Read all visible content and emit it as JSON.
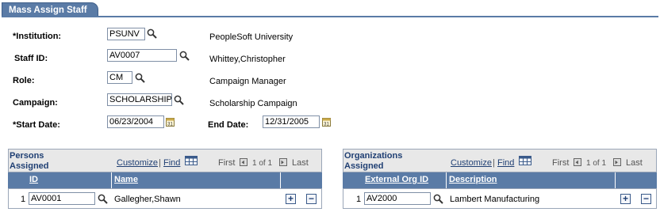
{
  "tab": {
    "label": "Mass Assign Staff"
  },
  "form": {
    "institution": {
      "label": "*Institution:",
      "value": "PSUNV",
      "description": "PeopleSoft University"
    },
    "staff_id": {
      "label": "Staff ID:",
      "value": "AV0007",
      "description": "Whittey,Christopher"
    },
    "role": {
      "label": "Role:",
      "value": "CM",
      "description": "Campaign Manager"
    },
    "campaign": {
      "label": "Campaign:",
      "value": "SCHOLARSHIP",
      "description": "Scholarship Campaign"
    },
    "start_date": {
      "label": "*Start Date:",
      "value": "06/23/2004"
    },
    "end_date": {
      "label": "End Date:",
      "value": "12/31/2005"
    }
  },
  "persons_grid": {
    "title": "Persons Assigned",
    "customize": "Customize",
    "sep": "|",
    "find": "Find",
    "first": "First",
    "count": "1 of 1",
    "last": "Last",
    "columns": [
      "ID",
      "Name"
    ],
    "rows": [
      {
        "num": "1",
        "id": "AV0001",
        "name": "Gallegher,Shawn"
      }
    ]
  },
  "orgs_grid": {
    "title": "Organizations Assigned",
    "customize": "Customize",
    "sep": "|",
    "find": "Find",
    "first": "First",
    "count": "1 of 1",
    "last": "Last",
    "columns": [
      "External Org ID",
      "Description"
    ],
    "rows": [
      {
        "num": "1",
        "id": "AV2000",
        "description": "Lambert Manufacturing"
      }
    ]
  },
  "icons": {
    "lookup": "magnifier-icon",
    "calendar": "calendar-icon",
    "add": "plus-icon",
    "delete": "minus-icon",
    "grid_view": "grid-icon"
  },
  "colors": {
    "accent": "#5a7ba6",
    "link": "#1f3f73"
  }
}
